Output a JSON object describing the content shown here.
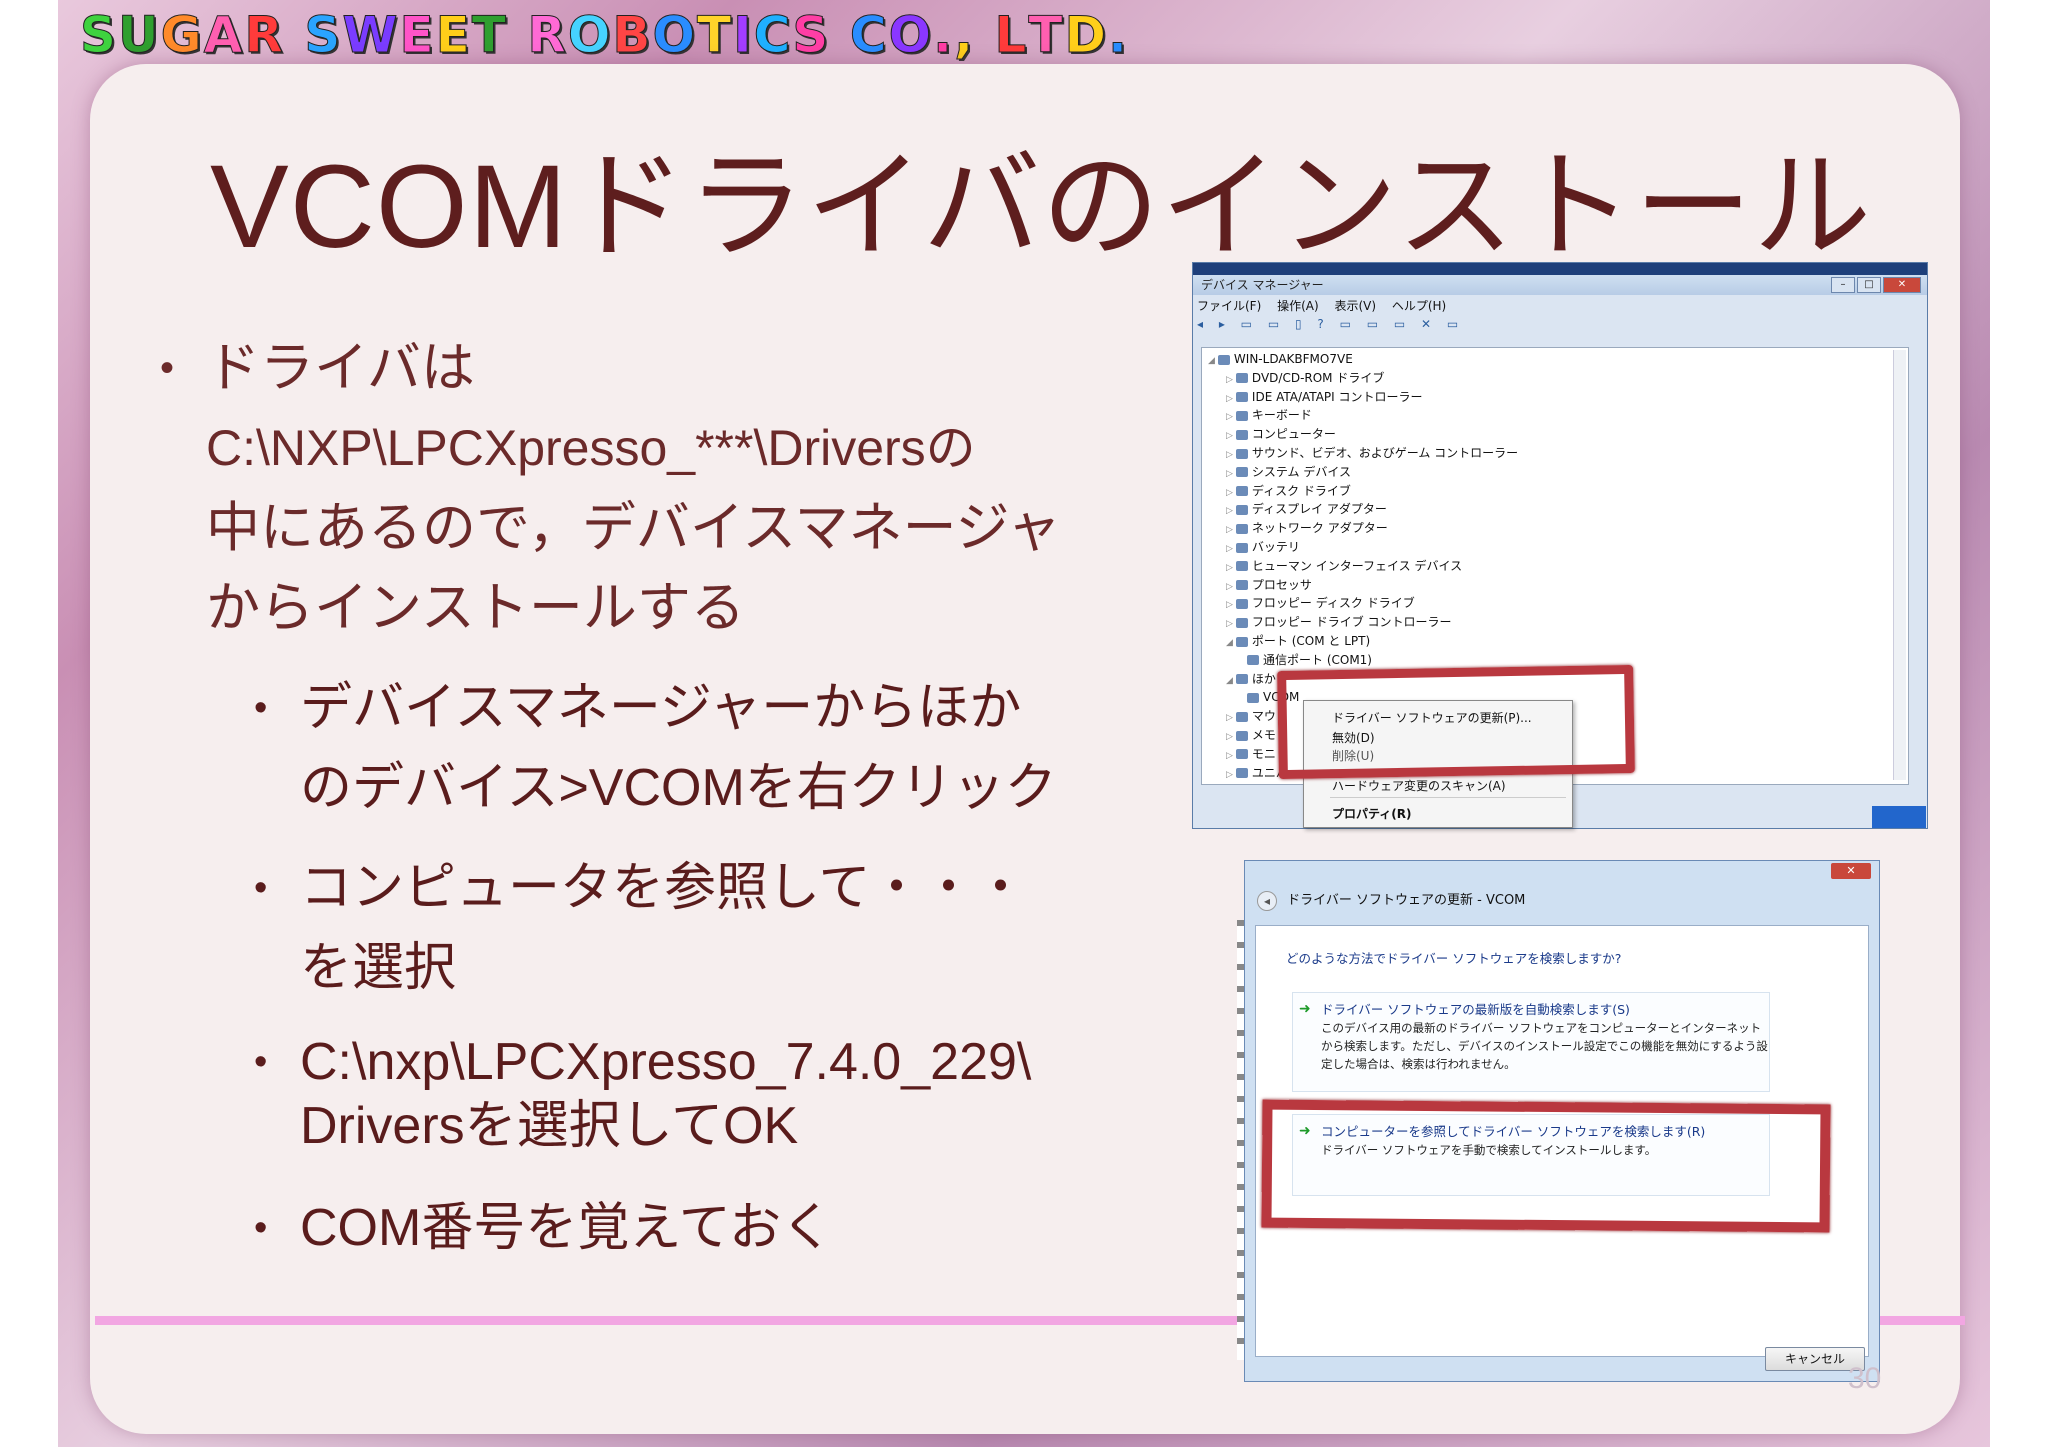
{
  "logo": {
    "letters": [
      {
        "ch": "S",
        "color": "#3fd23f"
      },
      {
        "ch": "U",
        "color": "#2f9f2f"
      },
      {
        "ch": "G",
        "color": "#ff8a2a"
      },
      {
        "ch": "A",
        "color": "#ff5fb0"
      },
      {
        "ch": "R",
        "color": "#ff3b3b"
      },
      {
        "ch": " ",
        "color": "#000"
      },
      {
        "ch": "S",
        "color": "#2aa4ff"
      },
      {
        "ch": "W",
        "color": "#7a3cff"
      },
      {
        "ch": "E",
        "color": "#ff54c8"
      },
      {
        "ch": "E",
        "color": "#ffcf1a"
      },
      {
        "ch": "T",
        "color": "#2f9f2f"
      },
      {
        "ch": " ",
        "color": "#000"
      },
      {
        "ch": "R",
        "color": "#ff6ad5"
      },
      {
        "ch": "O",
        "color": "#46d3ff"
      },
      {
        "ch": "B",
        "color": "#ff4545"
      },
      {
        "ch": "O",
        "color": "#2a8dff"
      },
      {
        "ch": "T",
        "color": "#ffd42a"
      },
      {
        "ch": "I",
        "color": "#a23dff"
      },
      {
        "ch": "C",
        "color": "#1fb0ff"
      },
      {
        "ch": "S",
        "color": "#ff3ea5"
      },
      {
        "ch": " ",
        "color": "#000"
      },
      {
        "ch": "C",
        "color": "#2a8dff"
      },
      {
        "ch": "O",
        "color": "#8a37ff"
      },
      {
        "ch": ".",
        "color": "#ff3ea5"
      },
      {
        "ch": ",",
        "color": "#ffcf1a"
      },
      {
        "ch": " ",
        "color": "#000"
      },
      {
        "ch": "L",
        "color": "#ff3b3b"
      },
      {
        "ch": "T",
        "color": "#ff5fb0"
      },
      {
        "ch": "D",
        "color": "#ffcf1a"
      },
      {
        "ch": ".",
        "color": "#2a8dff"
      }
    ]
  },
  "slide": {
    "title": "VCOMドライバのインストール",
    "bullet1": {
      "dot": "•",
      "lines": [
        "ドライバは",
        "C:\\NXP\\LPCXpresso_***\\Driversの",
        "中にあるので，デバイスマネージャ",
        "からインストールする"
      ]
    },
    "subbullets": [
      {
        "lines": [
          "デバイスマネージャーからほか",
          "のデバイス>VCOMを右クリック"
        ]
      },
      {
        "lines": [
          "コンピュータを参照して・・・",
          "を選択"
        ]
      },
      {
        "lines": [
          "C:\\nxp\\LPCXpresso_7.4.0_229\\",
          "Driversを選択してOK"
        ]
      },
      {
        "lines": [
          "COM番号を覚えておく"
        ]
      }
    ],
    "page_number": "30"
  },
  "device_manager": {
    "title": "デバイス マネージャー",
    "menu": "ファイル(F)  操作(A)  表示(V)  ヘルプ(H)",
    "toolbar_icons": "◂ ▸ ▭ ▭ ▯ ? ▭ ▭ ▭ ✕ ▭",
    "tree": [
      {
        "indent": 0,
        "label": "WIN-LDAKBFMO7VE"
      },
      {
        "indent": 1,
        "label": "DVD/CD-ROM ドライブ"
      },
      {
        "indent": 1,
        "label": "IDE ATA/ATAPI コントローラー"
      },
      {
        "indent": 1,
        "label": "キーボード"
      },
      {
        "indent": 1,
        "label": "コンピューター"
      },
      {
        "indent": 1,
        "label": "サウンド、ビデオ、およびゲーム コントローラー"
      },
      {
        "indent": 1,
        "label": "システム デバイス"
      },
      {
        "indent": 1,
        "label": "ディスク ドライブ"
      },
      {
        "indent": 1,
        "label": "ディスプレイ アダプター"
      },
      {
        "indent": 1,
        "label": "ネットワーク アダプター"
      },
      {
        "indent": 1,
        "label": "バッテリ"
      },
      {
        "indent": 1,
        "label": "ヒューマン インターフェイス デバイス"
      },
      {
        "indent": 1,
        "label": "プロセッサ"
      },
      {
        "indent": 1,
        "label": "フロッピー ディスク ドライブ"
      },
      {
        "indent": 1,
        "label": "フロッピー ドライブ コントローラー"
      },
      {
        "indent": 1,
        "label": "ポート (COM と LPT)"
      },
      {
        "indent": 2,
        "label": "通信ポート (COM1)"
      },
      {
        "indent": 1,
        "label": "ほか"
      },
      {
        "indent": 2,
        "label": "VCOM"
      },
      {
        "indent": 1,
        "label": "マウ"
      },
      {
        "indent": 1,
        "label": "メモ"
      },
      {
        "indent": 1,
        "label": "モニ"
      },
      {
        "indent": 1,
        "label": "ユニバ"
      }
    ],
    "context_menu": {
      "update": "ドライバー ソフトウェアの更新(P)...",
      "disable": "無効(D)",
      "uninstall": "削除(U)",
      "scan": "ハードウェア変更のスキャン(A)",
      "properties": "プロパティ(R)"
    }
  },
  "update_dialog": {
    "close": "✕",
    "title": "ドライバー ソフトウェアの更新 - VCOM",
    "question": "どのような方法でドライバー ソフトウェアを検索しますか?",
    "option_auto": {
      "title": "ドライバー ソフトウェアの最新版を自動検索します(S)",
      "desc": "このデバイス用の最新のドライバー ソフトウェアをコンピューターとインターネットから検索します。ただし、デバイスのインストール設定でこの機能を無効にするよう設定した場合は、検索は行われません。"
    },
    "option_browse": {
      "title": "コンピューターを参照してドライバー ソフトウェアを検索します(R)",
      "desc": "ドライバー ソフトウェアを手動で検索してインストールします。"
    },
    "cancel": "キャンセル"
  }
}
